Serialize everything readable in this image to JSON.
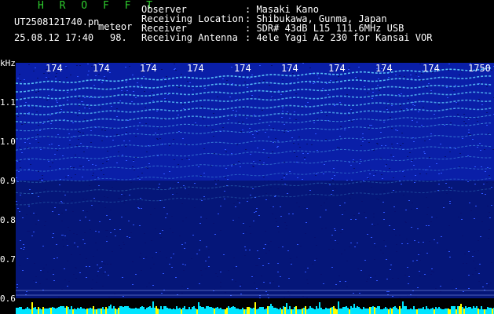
{
  "header": {
    "title": "H R O F F T",
    "filename": "UT2508121740.pn",
    "meteor_label": "meteor",
    "datetime": "25.08.12 17:40",
    "count": "98.",
    "fields": [
      {
        "label": "Observer",
        "value": ": Masaki Kano"
      },
      {
        "label": "Receiving Location",
        "value": ": Shibukawa, Gunma, Japan"
      },
      {
        "label": "Receiver",
        "value": ": SDR# 43dB L15 111.6MHz USB"
      },
      {
        "label": "Receiving Antenna",
        "value": ": 4ele Yagi Az 230 for Kansai VOR"
      }
    ]
  },
  "axis": {
    "y_unit": "kHz",
    "y_ticks": [
      "1.1",
      "1.0",
      "0.9",
      "0.8",
      "0.7",
      "0.6"
    ],
    "x_ticks": [
      "174",
      "174",
      "174",
      "174",
      "174",
      "174",
      "174",
      "174",
      "174",
      "1750"
    ]
  },
  "colors": {
    "background": "#000000",
    "spectro_base": "#0a1fa8",
    "line": "#5fd0ff",
    "title": "#2ecc2e",
    "baseline": "#00e5ff"
  }
}
